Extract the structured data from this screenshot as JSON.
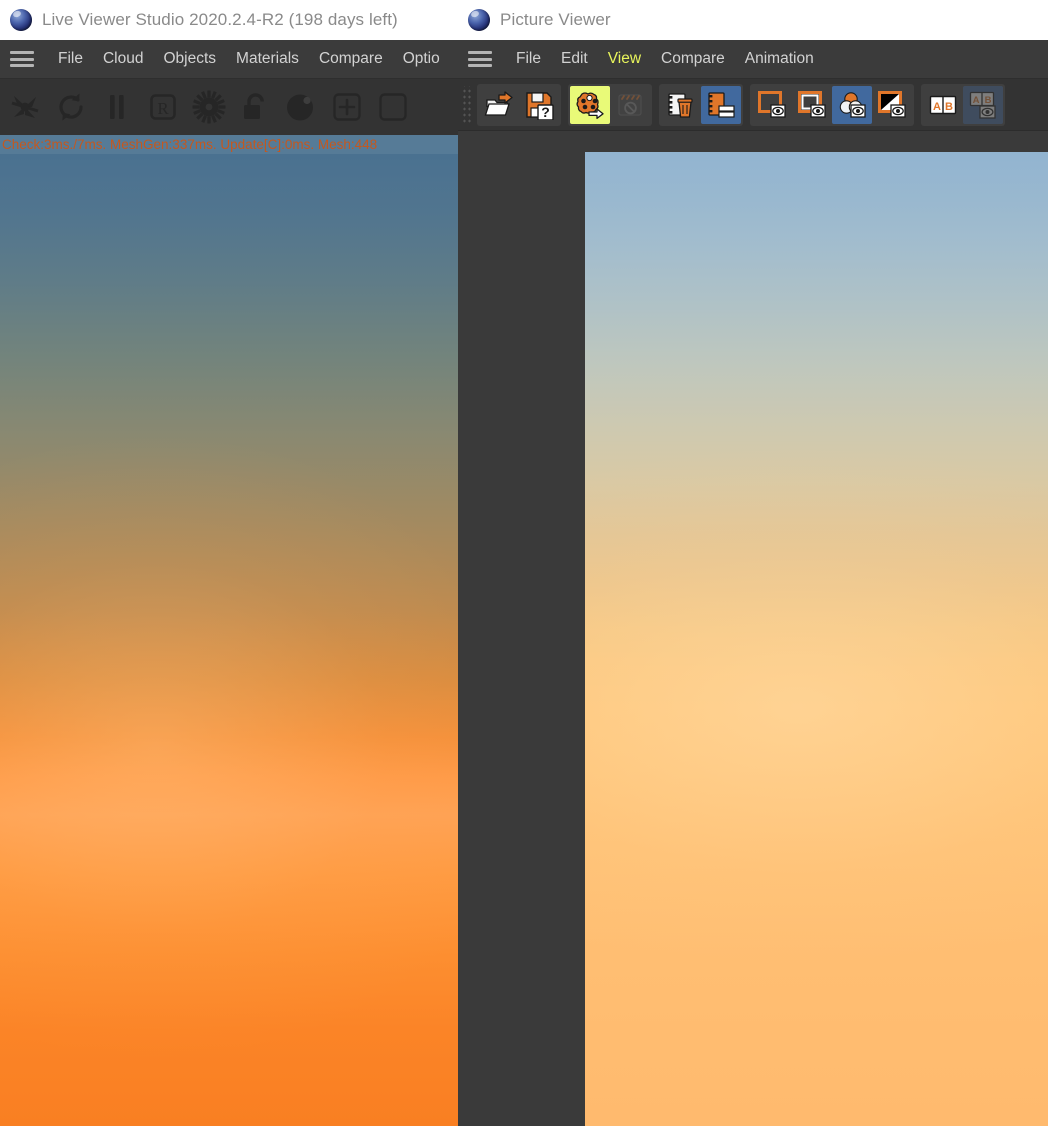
{
  "live_viewer": {
    "title": "Live Viewer Studio 2020.2.4-R2 (198 days left)",
    "app_icon": "sphere-logo-icon",
    "menu": [
      {
        "label": "File",
        "name": "menu-file"
      },
      {
        "label": "Cloud",
        "name": "menu-cloud"
      },
      {
        "label": "Objects",
        "name": "menu-objects"
      },
      {
        "label": "Materials",
        "name": "menu-materials"
      },
      {
        "label": "Compare",
        "name": "menu-compare"
      },
      {
        "label": "Optio",
        "name": "menu-options"
      }
    ],
    "toolbar": [
      {
        "name": "stop-render-icon",
        "title": "Stop Render"
      },
      {
        "name": "refresh-icon",
        "title": "Refresh"
      },
      {
        "name": "pause-icon",
        "title": "Pause"
      },
      {
        "name": "region-r-icon",
        "title": "Render Region"
      },
      {
        "name": "gear-sun-icon",
        "title": "Settings"
      },
      {
        "name": "unlock-icon",
        "title": "Lock Camera"
      },
      {
        "name": "sphere-preview-icon",
        "title": "Material Preview"
      },
      {
        "name": "add-plus-icon",
        "title": "Add"
      },
      {
        "name": "extra-icon",
        "title": "More"
      }
    ],
    "status_text": "Check:3ms./7ms. MeshGen:337ms. Update[C]:0ms. Mesh:448",
    "status_bg": "#567b97",
    "status_fg": "#c4581f",
    "viewport_name": "render-viewport"
  },
  "picture_viewer": {
    "title": "Picture Viewer",
    "app_icon": "sphere-logo-icon",
    "menu": [
      {
        "label": "File",
        "name": "menu-file",
        "active": false
      },
      {
        "label": "Edit",
        "name": "menu-edit",
        "active": false
      },
      {
        "label": "View",
        "name": "menu-view",
        "active": true
      },
      {
        "label": "Compare",
        "name": "menu-compare",
        "active": false
      },
      {
        "label": "Animation",
        "name": "menu-animation",
        "active": false
      }
    ],
    "active_menu_color": "#e8f55c",
    "toolbar_groups": [
      {
        "name": "file-group",
        "buttons": [
          {
            "name": "open-image-icon",
            "title": "Open Image",
            "state": "normal"
          },
          {
            "name": "save-image-as-icon",
            "title": "Save Image As",
            "state": "normal"
          }
        ]
      },
      {
        "name": "render-group",
        "buttons": [
          {
            "name": "render-to-picture-viewer-icon",
            "title": "Render To Picture Viewer",
            "state": "highlighted"
          },
          {
            "name": "stop-render-icon",
            "title": "Stop Render",
            "state": "disabled"
          }
        ]
      },
      {
        "name": "history-group",
        "buttons": [
          {
            "name": "delete-image-icon",
            "title": "Delete Image",
            "state": "normal"
          },
          {
            "name": "image-history-icon",
            "title": "Image History",
            "state": "selected"
          }
        ]
      },
      {
        "name": "display-group",
        "buttons": [
          {
            "name": "show-border-icon",
            "title": "Show Border",
            "state": "normal"
          },
          {
            "name": "show-safe-frame-icon",
            "title": "Show Safe Frame",
            "state": "normal"
          },
          {
            "name": "show-color-channels-icon",
            "title": "Color Channels",
            "state": "selected"
          },
          {
            "name": "show-alpha-channel-icon",
            "title": "Alpha Channel",
            "state": "normal"
          }
        ]
      },
      {
        "name": "compare-group",
        "buttons": [
          {
            "name": "ab-compare-icon",
            "title": "A/B Compare",
            "state": "normal"
          },
          {
            "name": "ab-compare-view-icon",
            "title": "A/B Compare View",
            "state": "disabled-selected"
          }
        ]
      }
    ],
    "canvas_name": "picture-canvas",
    "image_name": "rendered-image-preview"
  },
  "colors": {
    "titlebar_bg": "#ffffff",
    "titlebar_fg": "#8a8a8a",
    "menubar_bg": "#3b3b3b",
    "toolbar_bg": "#333333",
    "canvas_bg": "#3a3a3a",
    "accent_orange": "#e0762a",
    "highlight_yellow": "#e9fa78",
    "selected_blue": "#41699e"
  }
}
